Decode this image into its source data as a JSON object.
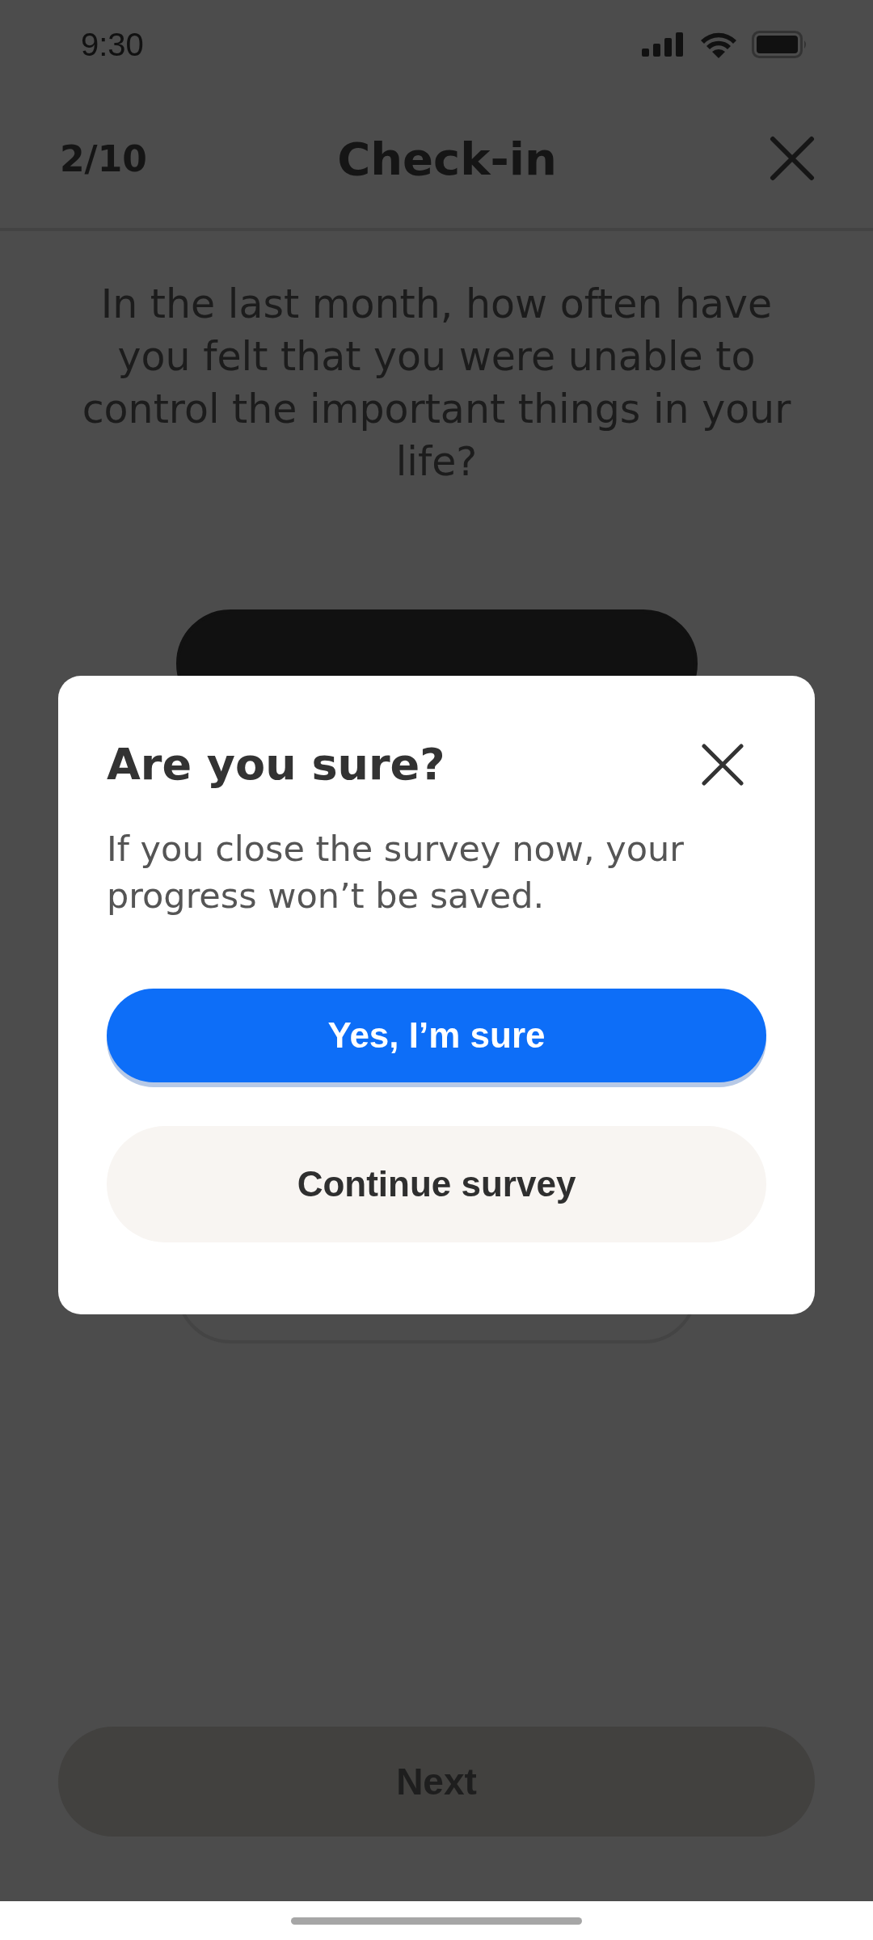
{
  "status_bar": {
    "time": "9:30"
  },
  "header": {
    "progress": "2/10",
    "title": "Check-in"
  },
  "question": "In the last month, how often have you felt that you were unable to control the important things in your life?",
  "options": [
    {
      "selected": true
    },
    {
      "selected": false
    }
  ],
  "next_button": {
    "label": "Next",
    "disabled": true
  },
  "dialog": {
    "title": "Are you sure?",
    "message": "If you close the survey now, your progress won’t be saved.",
    "buttons": [
      {
        "label": "Yes, I’m sure",
        "kind": "primary"
      },
      {
        "label": "Continue survey",
        "kind": "secondary"
      }
    ]
  }
}
